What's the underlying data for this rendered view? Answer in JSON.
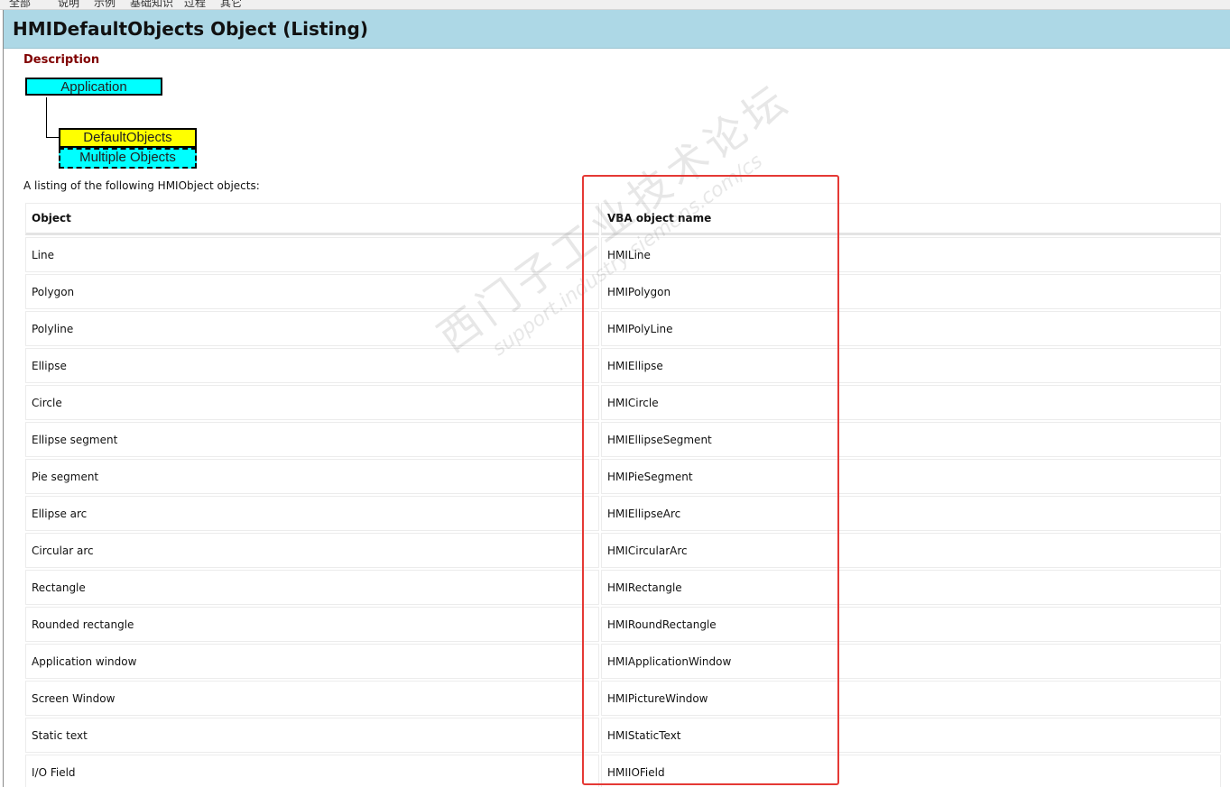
{
  "top_nav": {
    "items": [
      "全部",
      "说明",
      "示例",
      "基础知识",
      "过程",
      "其它"
    ]
  },
  "page": {
    "title": "HMIDefaultObjects Object (Listing)",
    "description_heading": "Description",
    "listing_intro": "A listing of the following HMIObject objects:"
  },
  "diagram": {
    "application": "Application",
    "default_objects": "DefaultObjects",
    "multiple_objects": "Multiple Objects"
  },
  "table": {
    "headers": [
      "Object",
      "VBA object name"
    ],
    "rows": [
      [
        "Line",
        "HMILine"
      ],
      [
        "Polygon",
        "HMIPolygon"
      ],
      [
        "Polyline",
        "HMIPolyLine"
      ],
      [
        "Ellipse",
        "HMIEllipse"
      ],
      [
        "Circle",
        "HMICircle"
      ],
      [
        "Ellipse segment",
        "HMIEllipseSegment"
      ],
      [
        "Pie segment",
        "HMIPieSegment"
      ],
      [
        "Ellipse arc",
        "HMIEllipseArc"
      ],
      [
        "Circular arc",
        "HMICircularArc"
      ],
      [
        "Rectangle",
        "HMIRectangle"
      ],
      [
        "Rounded rectangle",
        "HMIRoundRectangle"
      ],
      [
        "Application window",
        "HMIApplicationWindow"
      ],
      [
        "Screen Window",
        "HMIPictureWindow"
      ],
      [
        "Static text",
        "HMIStaticText"
      ],
      [
        "I/O Field",
        "HMIIOField"
      ]
    ]
  },
  "watermark": {
    "text_cn": "西门子工业技术论坛",
    "url": "support.industry.siemens.com/cs"
  },
  "colors": {
    "title_bar": "#add8e6",
    "description_heading": "#800000",
    "diagram_cyan": "#00ffff",
    "diagram_yellow": "#ffff00",
    "highlight_red": "#e53935"
  }
}
